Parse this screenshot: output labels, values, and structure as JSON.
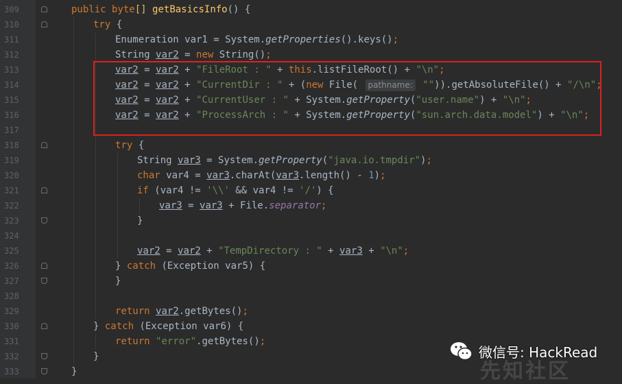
{
  "watermark": {
    "wechat_label": "微信号: HackRead",
    "site_label": "先知社区"
  },
  "lines": [
    {
      "num": "309",
      "fold": "open",
      "indent": 0,
      "html": "<span class=\"kw\">public</span> <span class=\"kw\">byte</span><span class=\"br\">[]</span> <span class=\"fn\">getBasicsInfo</span>() {"
    },
    {
      "num": "310",
      "fold": "open",
      "indent": 1,
      "html": "<span class=\"kw\">try</span> {"
    },
    {
      "num": "311",
      "fold": "",
      "indent": 2,
      "html": "Enumeration var1 = System.<span class=\"it\">getProperties</span>().keys()<span class=\"kw\">;</span>"
    },
    {
      "num": "312",
      "fold": "",
      "indent": 2,
      "html": "String <span class=\"ul\">var2</span> = <span class=\"kw\">new</span> String()<span class=\"kw\">;</span>"
    },
    {
      "num": "313",
      "fold": "",
      "indent": 2,
      "html": "<span class=\"ul\">var2</span> = <span class=\"ul\">var2</span> + <span class=\"str\">\"FileRoot : \"</span> + <span class=\"kw\">this</span>.listFileRoot() + <span class=\"str\">\"\\n\"</span><span class=\"kw\">;</span>"
    },
    {
      "num": "314",
      "fold": "",
      "indent": 2,
      "html": "<span class=\"ul\">var2</span> = <span class=\"ul\">var2</span> + <span class=\"str\">\"CurrentDir : \"</span> + (<span class=\"kw\">new</span> File( <span class=\"hint\">pathname:</span> <span class=\"str\">\"\"</span>)).getAbsoluteFile() + <span class=\"str\">\"/\\n\"</span><span class=\"kw\">;</span>"
    },
    {
      "num": "315",
      "fold": "",
      "indent": 2,
      "html": "<span class=\"ul\">var2</span> = <span class=\"ul\">var2</span> + <span class=\"str\">\"CurrentUser : \"</span> + System.<span class=\"it\">getProperty</span>(<span class=\"str\">\"user.name\"</span>) + <span class=\"str\">\"\\n\"</span><span class=\"kw\">;</span>"
    },
    {
      "num": "316",
      "fold": "",
      "indent": 2,
      "html": "<span class=\"ul\">var2</span> = <span class=\"ul\">var2</span> + <span class=\"str\">\"ProcessArch : \"</span> + System.<span class=\"it\">getProperty</span>(<span class=\"str\">\"sun.arch.data.model\"</span>) + <span class=\"str\">\"\\n\"</span><span class=\"kw\">;</span>"
    },
    {
      "num": "317",
      "fold": "",
      "indent": 2,
      "html": ""
    },
    {
      "num": "318",
      "fold": "open",
      "indent": 2,
      "html": "<span class=\"kw\">try</span> {"
    },
    {
      "num": "319",
      "fold": "",
      "indent": 3,
      "html": "String <span class=\"ul\">var3</span> = System.<span class=\"it\">getProperty</span>(<span class=\"str\">\"java.io.tmpdir\"</span>)<span class=\"kw\">;</span>"
    },
    {
      "num": "320",
      "fold": "",
      "indent": 3,
      "html": "<span class=\"kw\">char</span> var4 = <span class=\"ul\">var3</span>.charAt(<span class=\"ul\">var3</span>.length() - <span class=\"num\">1</span>)<span class=\"kw\">;</span>"
    },
    {
      "num": "321",
      "fold": "open",
      "indent": 3,
      "html": "<span class=\"kw\">if</span> (var4 != <span class=\"str\">'\\\\'</span> &amp;&amp; var4 != <span class=\"str\">'/'</span>) {"
    },
    {
      "num": "322",
      "fold": "",
      "indent": 4,
      "html": "<span class=\"ul\">var3</span> = <span class=\"ul\">var3</span> + File.<span class=\"fld\">separator</span><span class=\"kw\">;</span>"
    },
    {
      "num": "323",
      "fold": "close",
      "indent": 3,
      "html": "}"
    },
    {
      "num": "324",
      "fold": "",
      "indent": 3,
      "html": ""
    },
    {
      "num": "325",
      "fold": "",
      "indent": 3,
      "html": "<span class=\"ul\">var2</span> = <span class=\"ul\">var2</span> + <span class=\"str\">\"TempDirectory : \"</span> + <span class=\"ul\">var3</span> + <span class=\"str\">\"\\n\"</span><span class=\"kw\">;</span>"
    },
    {
      "num": "326",
      "fold": "open",
      "indent": 2,
      "html": "} <span class=\"kw\">catch</span> (Exception var5) {"
    },
    {
      "num": "327",
      "fold": "close",
      "indent": 2,
      "html": "}"
    },
    {
      "num": "328",
      "fold": "",
      "indent": 2,
      "html": ""
    },
    {
      "num": "329",
      "fold": "",
      "indent": 2,
      "html": "<span class=\"kw\">return</span> <span class=\"ul\">var2</span>.getBytes()<span class=\"kw\">;</span>"
    },
    {
      "num": "330",
      "fold": "open",
      "indent": 1,
      "html": "} <span class=\"kw\">catch</span> (Exception var6) {"
    },
    {
      "num": "331",
      "fold": "",
      "indent": 2,
      "html": "<span class=\"kw\">return</span> <span class=\"str\">\"error\"</span>.getBytes()<span class=\"kw\">;</span>"
    },
    {
      "num": "332",
      "fold": "close",
      "indent": 1,
      "html": "}"
    },
    {
      "num": "333",
      "fold": "close",
      "indent": 0,
      "html": "}"
    }
  ]
}
